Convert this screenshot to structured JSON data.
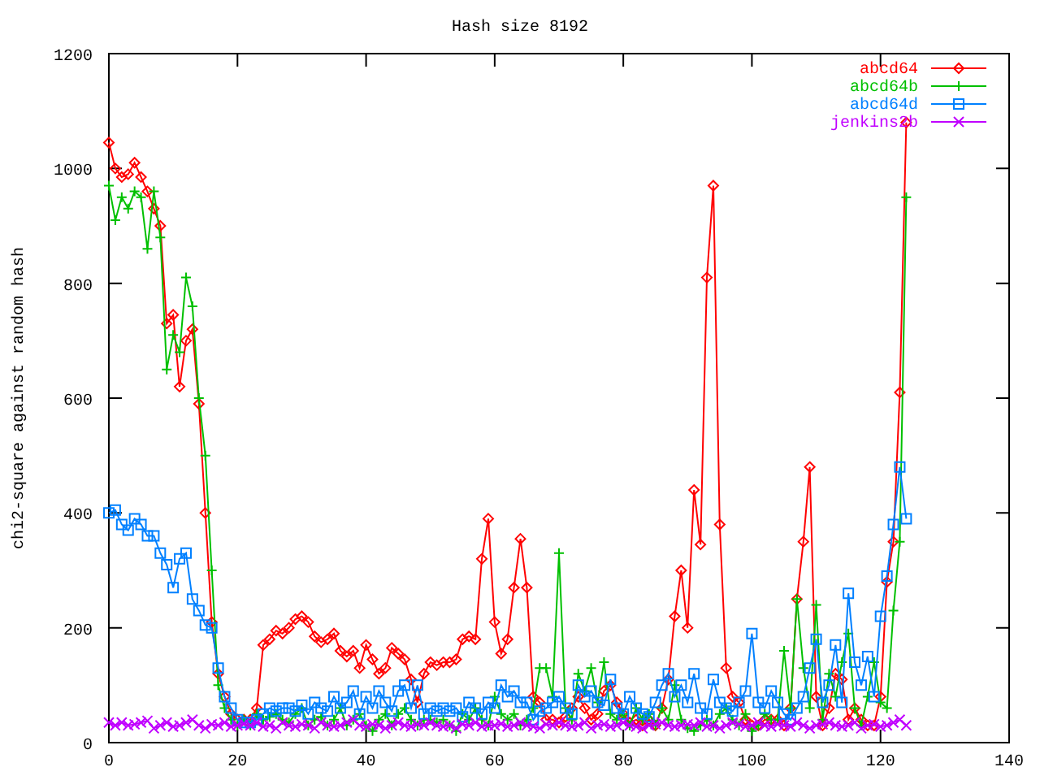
{
  "chart_data": {
    "type": "line",
    "title": "Hash size 8192",
    "ylabel": "chi2-square against random hash",
    "x": [
      0,
      1,
      2,
      3,
      4,
      5,
      6,
      7,
      8,
      9,
      10,
      11,
      12,
      13,
      14,
      15,
      16,
      17,
      18,
      19,
      20,
      21,
      22,
      23,
      24,
      25,
      26,
      27,
      28,
      29,
      30,
      31,
      32,
      33,
      34,
      35,
      36,
      37,
      38,
      39,
      40,
      41,
      42,
      43,
      44,
      45,
      46,
      47,
      48,
      49,
      50,
      51,
      52,
      53,
      54,
      55,
      56,
      57,
      58,
      59,
      60,
      61,
      62,
      63,
      64,
      65,
      66,
      67,
      68,
      69,
      70,
      71,
      72,
      73,
      74,
      75,
      76,
      77,
      78,
      79,
      80,
      81,
      82,
      83,
      84,
      85,
      86,
      87,
      88,
      89,
      90,
      91,
      92,
      93,
      94,
      95,
      96,
      97,
      98,
      99,
      100,
      101,
      102,
      103,
      104,
      105,
      106,
      107,
      108,
      109,
      110,
      111,
      112,
      113,
      114,
      115,
      116,
      117,
      118,
      119,
      120,
      121,
      122,
      123,
      124
    ],
    "series": [
      {
        "name": "abcd64",
        "color": "#ff0000",
        "marker": "diamond",
        "values": [
          1045,
          1000,
          985,
          990,
          1010,
          985,
          960,
          930,
          900,
          730,
          745,
          620,
          700,
          720,
          590,
          400,
          210,
          120,
          80,
          50,
          40,
          40,
          40,
          60,
          170,
          180,
          195,
          190,
          200,
          215,
          220,
          210,
          185,
          175,
          180,
          190,
          160,
          150,
          160,
          130,
          170,
          145,
          120,
          130,
          165,
          155,
          145,
          110,
          70,
          120,
          140,
          135,
          140,
          140,
          145,
          180,
          185,
          180,
          320,
          390,
          210,
          155,
          180,
          270,
          355,
          270,
          80,
          70,
          40,
          40,
          35,
          45,
          60,
          80,
          60,
          40,
          50,
          90,
          100,
          70,
          50,
          35,
          40,
          30,
          40,
          30,
          60,
          110,
          220,
          300,
          200,
          440,
          345,
          810,
          970,
          380,
          130,
          80,
          70,
          40,
          30,
          30,
          40,
          40,
          40,
          30,
          60,
          250,
          350,
          480,
          80,
          30,
          60,
          120,
          110,
          40,
          60,
          40,
          30,
          30,
          80,
          280,
          350,
          610,
          1080
        ]
      },
      {
        "name": "abcd64b",
        "color": "#00c000",
        "marker": "plus",
        "values": [
          970,
          910,
          950,
          930,
          960,
          950,
          860,
          960,
          880,
          650,
          710,
          680,
          810,
          760,
          600,
          500,
          300,
          100,
          60,
          40,
          30,
          40,
          30,
          50,
          40,
          45,
          50,
          40,
          35,
          50,
          60,
          30,
          40,
          45,
          30,
          40,
          60,
          30,
          40,
          50,
          30,
          20,
          40,
          50,
          30,
          50,
          60,
          40,
          30,
          40,
          40,
          35,
          40,
          30,
          20,
          50,
          40,
          60,
          40,
          30,
          80,
          50,
          40,
          50,
          30,
          40,
          60,
          130,
          130,
          80,
          330,
          60,
          40,
          120,
          90,
          130,
          70,
          140,
          50,
          40,
          50,
          30,
          60,
          40,
          50,
          30,
          60,
          40,
          100,
          40,
          25,
          20,
          30,
          40,
          30,
          50,
          60,
          40,
          30,
          50,
          20,
          30,
          50,
          40,
          40,
          160,
          60,
          250,
          130,
          60,
          240,
          40,
          120,
          80,
          140,
          190,
          60,
          30,
          80,
          140,
          70,
          60,
          230,
          350,
          950
        ]
      },
      {
        "name": "abcd64d",
        "color": "#0080ff",
        "marker": "square",
        "values": [
          400,
          405,
          380,
          370,
          390,
          380,
          360,
          360,
          330,
          310,
          270,
          320,
          330,
          250,
          230,
          205,
          200,
          130,
          80,
          60,
          40,
          35,
          35,
          40,
          50,
          60,
          55,
          60,
          60,
          55,
          65,
          50,
          70,
          60,
          55,
          80,
          60,
          70,
          90,
          50,
          80,
          60,
          90,
          70,
          55,
          90,
          100,
          60,
          100,
          50,
          60,
          55,
          60,
          55,
          60,
          45,
          70,
          60,
          50,
          70,
          60,
          100,
          80,
          90,
          70,
          70,
          40,
          55,
          60,
          70,
          80,
          60,
          50,
          100,
          80,
          90,
          70,
          65,
          110,
          60,
          50,
          80,
          60,
          50,
          45,
          70,
          100,
          120,
          80,
          100,
          70,
          120,
          60,
          50,
          110,
          70,
          60,
          55,
          70,
          90,
          190,
          70,
          60,
          90,
          70,
          50,
          40,
          60,
          80,
          130,
          180,
          70,
          100,
          170,
          70,
          260,
          140,
          100,
          150,
          80,
          220,
          290,
          380,
          480,
          390
        ]
      },
      {
        "name": "jenkins2b",
        "color": "#c000ff",
        "marker": "cross",
        "values": [
          35,
          30,
          35,
          30,
          32,
          35,
          38,
          25,
          30,
          35,
          28,
          30,
          35,
          40,
          30,
          25,
          32,
          30,
          35,
          28,
          30,
          33,
          30,
          35,
          28,
          30,
          25,
          35,
          30,
          28,
          32,
          30,
          25,
          35,
          30,
          28,
          30,
          35,
          40,
          30,
          28,
          32,
          30,
          25,
          30,
          35,
          30,
          28,
          32,
          30,
          35,
          30,
          28,
          30,
          25,
          32,
          30,
          35,
          28,
          30,
          30,
          33,
          28,
          30,
          35,
          30,
          28,
          25,
          32,
          30,
          35,
          30,
          28,
          30,
          35,
          25,
          30,
          32,
          28,
          30,
          35,
          30,
          28,
          25,
          30,
          32,
          35,
          30,
          28,
          30,
          32,
          30,
          35,
          28,
          30,
          25,
          30,
          35,
          32,
          28,
          30,
          35,
          30,
          28,
          32,
          30,
          28,
          35,
          30,
          25,
          30,
          32,
          35,
          30,
          28,
          30,
          35,
          25,
          30,
          32,
          28,
          30,
          35,
          40,
          30
        ]
      }
    ],
    "legend": true,
    "xlim": [
      0,
      140
    ],
    "ylim": [
      0,
      1200
    ],
    "xticks": [
      0,
      20,
      40,
      60,
      80,
      100,
      120,
      140
    ],
    "yticks": [
      0,
      200,
      400,
      600,
      800,
      1000,
      1200
    ]
  }
}
